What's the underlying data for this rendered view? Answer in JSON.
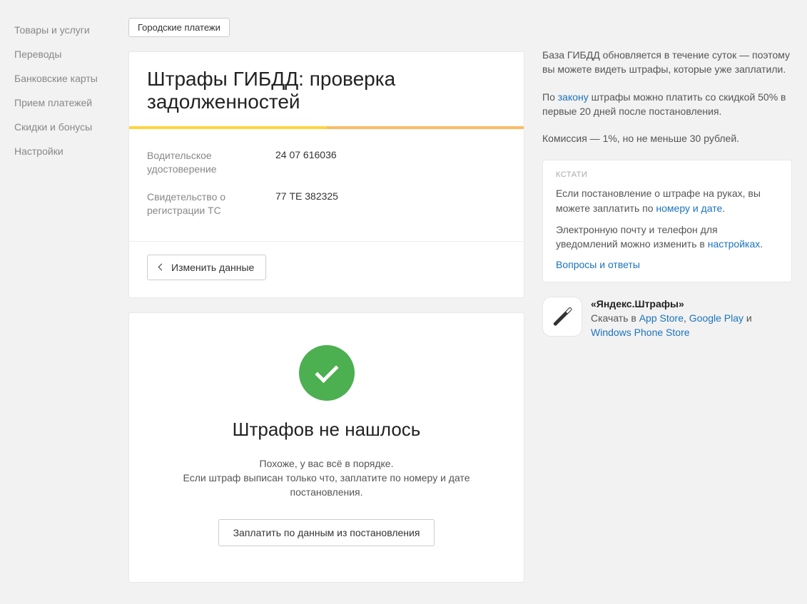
{
  "sidebar": {
    "items": [
      {
        "label": "Товары и услуги"
      },
      {
        "label": "Переводы"
      },
      {
        "label": "Банковские карты"
      },
      {
        "label": "Прием платежей"
      },
      {
        "label": "Скидки и бонусы"
      },
      {
        "label": "Настройки"
      }
    ]
  },
  "main": {
    "city_btn": "Городские платежи",
    "title": "Штрафы ГИБДД: проверка задолженностей",
    "fields": [
      {
        "label": "Водительское удостоверение",
        "value": "24 07 616036"
      },
      {
        "label": "Свидетельство о регистрации ТС",
        "value": "77 ТЕ 382325"
      }
    ],
    "change_btn": "Изменить данные",
    "result": {
      "title": "Штрафов не нашлось",
      "line1": "Похоже, у вас всё в порядке.",
      "line2": "Если штраф выписан только что, заплатите по номеру и дате постановления.",
      "pay_btn": "Заплатить по данным из постановления"
    }
  },
  "aside": {
    "info1": "База ГИБДД обновляется в течение суток — поэтому вы можете видеть штрафы, которые уже заплатили.",
    "info2a": "По ",
    "info2_link": "закону",
    "info2b": " штрафы можно платить со скидкой 50% в первые 20 дней после постановления.",
    "info3": "Комиссия — 1%, но не меньше 30 рублей.",
    "tip": {
      "label": "КСТАТИ",
      "p1a": "Если постановление о штрафе на руках, вы можете заплатить по ",
      "p1_link": "номеру и дате",
      "p1b": ".",
      "p2a": "Электронную почту и телефон для уведомлений можно изменить в ",
      "p2_link": "настройках",
      "p2b": ".",
      "qa_link": "Вопросы и ответы"
    },
    "app": {
      "title": "«Яндекс.Штрафы»",
      "prefix": "Скачать в ",
      "link1": "App Store",
      "sep1": ", ",
      "link2": "Google Play",
      "sep2": " и ",
      "link3": "Windows Phone Store"
    }
  }
}
